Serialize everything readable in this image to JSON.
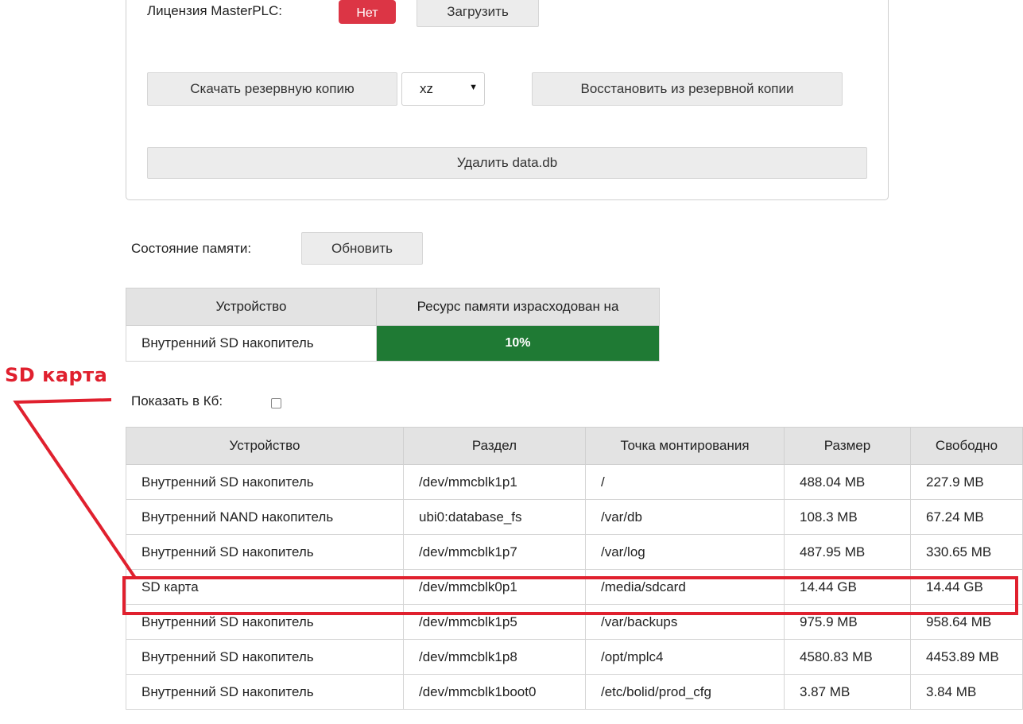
{
  "license": {
    "label": "Лицензия MasterPLC:",
    "status": "Нет",
    "upload_button": "Загрузить"
  },
  "backup": {
    "download_button": "Скачать резервную копию",
    "format_selected": "xz",
    "restore_button": "Восстановить из резервной копии",
    "delete_button": "Удалить data.db"
  },
  "memory": {
    "label": "Состояние памяти:",
    "refresh_button": "Обновить",
    "headers": [
      "Устройство",
      "Ресурс памяти израсходован на"
    ],
    "rows": [
      {
        "device": "Внутренний SD накопитель",
        "usage": "10%",
        "usage_fraction": 0.1
      }
    ],
    "bar_color": "#1f7a34"
  },
  "show_kb": {
    "label": "Показать в Кб:",
    "checked": false
  },
  "partitions": {
    "headers": [
      "Устройство",
      "Раздел",
      "Точка монтирования",
      "Размер",
      "Свободно"
    ],
    "rows": [
      [
        "Внутренний SD накопитель",
        "/dev/mmcblk1p1",
        "/",
        "488.04 MB",
        "227.9 MB"
      ],
      [
        "Внутренний NAND накопитель",
        "ubi0:database_fs",
        "/var/db",
        "108.3 MB",
        "67.24 MB"
      ],
      [
        "Внутренний SD накопитель",
        "/dev/mmcblk1p7",
        "/var/log",
        "487.95 MB",
        "330.65 MB"
      ],
      [
        "SD карта",
        "/dev/mmcblk0p1",
        "/media/sdcard",
        "14.44 GB",
        "14.44 GB"
      ],
      [
        "Внутренний SD накопитель",
        "/dev/mmcblk1p5",
        "/var/backups",
        "975.9 MB",
        "958.64 MB"
      ],
      [
        "Внутренний SD накопитель",
        "/dev/mmcblk1p8",
        "/opt/mplc4",
        "4580.83 MB",
        "4453.89 MB"
      ],
      [
        "Внутренний SD накопитель",
        "/dev/mmcblk1boot0",
        "/etc/bolid/prod_cfg",
        "3.87 MB",
        "3.84 MB"
      ]
    ]
  },
  "annotation": {
    "label": "SD  карта",
    "color": "#e0202e"
  }
}
